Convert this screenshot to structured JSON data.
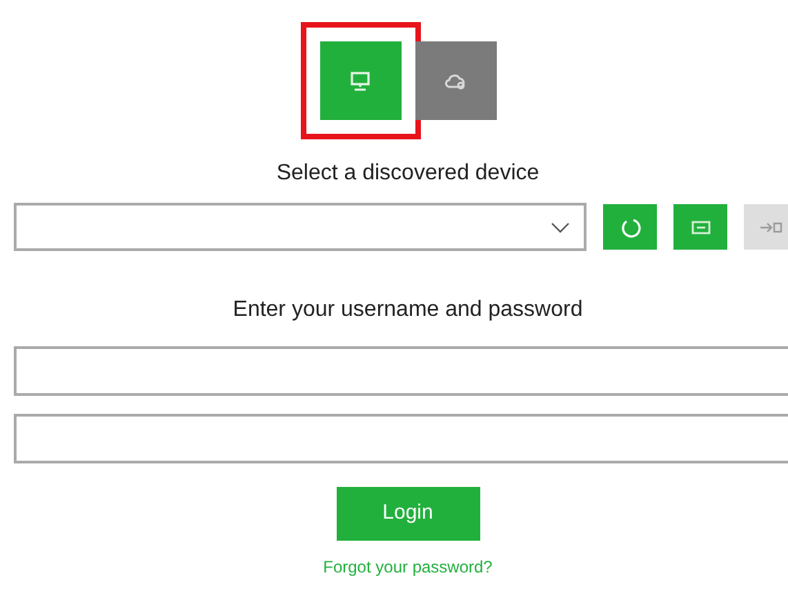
{
  "mode_buttons": [
    {
      "kind": "local",
      "selected": true,
      "highlighted": true
    },
    {
      "kind": "cloud",
      "selected": false,
      "highlighted": false
    }
  ],
  "device_section": {
    "label": "Select a discovered device",
    "tool_buttons": [
      {
        "kind": "refresh",
        "disabled": false
      },
      {
        "kind": "keyboard",
        "disabled": false
      },
      {
        "kind": "connect",
        "disabled": true
      }
    ]
  },
  "credentials": {
    "label": "Enter your username and password"
  },
  "login_button": "Login",
  "forgot_link": "Forgot your password?"
}
